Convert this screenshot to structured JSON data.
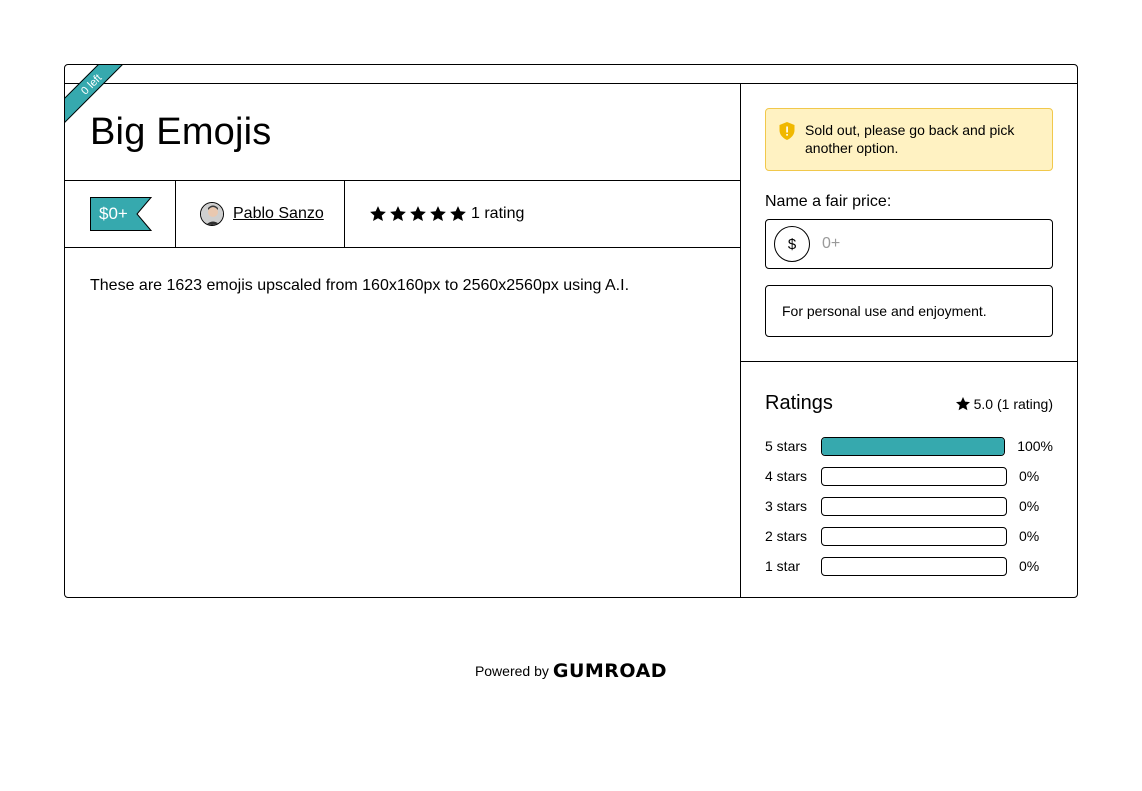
{
  "ribbon": {
    "text": "0 left"
  },
  "product": {
    "title": "Big Emojis",
    "price_tag": "$0+",
    "author": "Pablo Sanzo",
    "rating_label": "1 rating",
    "star_count": 5,
    "description": "These are 1623 emojis upscaled from 160x160px to 2560x2560px using A.I."
  },
  "checkout": {
    "alert": "Sold out, please go back and pick another option.",
    "fair_price_label": "Name a fair price:",
    "currency_symbol": "$",
    "price_placeholder": "0+",
    "note": "For personal use and enjoyment."
  },
  "ratings": {
    "title": "Ratings",
    "summary": "5.0 (1 rating)",
    "rows": [
      {
        "label": "5 stars",
        "percent": 100,
        "percent_text": "100%"
      },
      {
        "label": "4 stars",
        "percent": 0,
        "percent_text": "0%"
      },
      {
        "label": "3 stars",
        "percent": 0,
        "percent_text": "0%"
      },
      {
        "label": "2 stars",
        "percent": 0,
        "percent_text": "0%"
      },
      {
        "label": "1 star",
        "percent": 0,
        "percent_text": "0%"
      }
    ]
  },
  "footer": {
    "powered_by": "Powered by",
    "brand": "GUMROAD"
  },
  "colors": {
    "accent": "#36a9ae",
    "alert_bg": "#fff2c2",
    "alert_border": "#f1c84b"
  },
  "icons": {
    "star": "star-icon",
    "shield": "shield-icon",
    "avatar": "avatar"
  }
}
